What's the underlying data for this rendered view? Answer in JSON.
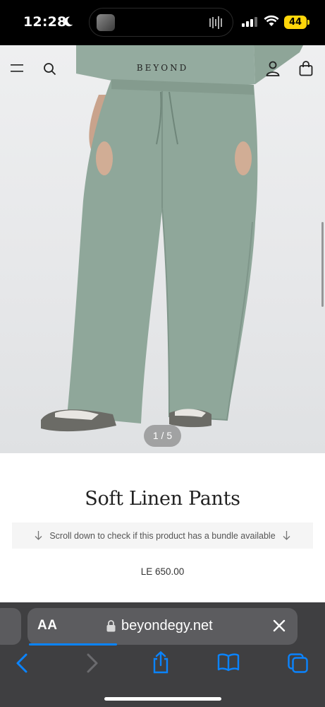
{
  "status_bar": {
    "time": "12:28",
    "battery": "44"
  },
  "header": {
    "logo": "BEYOND"
  },
  "gallery": {
    "counter": "1 / 5"
  },
  "product": {
    "title": "Soft Linen Pants",
    "bundle_notice": "Scroll down to check if this product has a bundle available",
    "price": "LE 650.00"
  },
  "browser": {
    "text_size_label": "AA",
    "url": "beyondegy.net",
    "page_load_progress": 0.33
  },
  "colors": {
    "accent": "#0a84ff",
    "pants": "#8fa79a",
    "battery": "#ffd60a"
  }
}
